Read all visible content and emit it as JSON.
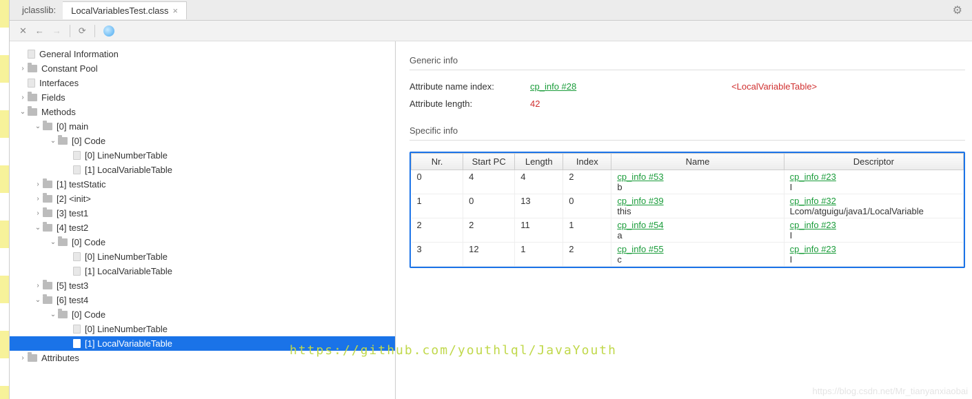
{
  "header": {
    "app": "jclasslib:",
    "tab": "LocalVariablesTest.class"
  },
  "tree": [
    {
      "indent": 0,
      "arrow": "",
      "icon": "file",
      "label": "General Information"
    },
    {
      "indent": 0,
      "arrow": "›",
      "icon": "folder",
      "label": "Constant Pool"
    },
    {
      "indent": 0,
      "arrow": "",
      "icon": "file",
      "label": "Interfaces"
    },
    {
      "indent": 0,
      "arrow": "›",
      "icon": "folder",
      "label": "Fields"
    },
    {
      "indent": 0,
      "arrow": "v",
      "icon": "folder",
      "label": "Methods"
    },
    {
      "indent": 1,
      "arrow": "v",
      "icon": "folder",
      "label": "[0] main"
    },
    {
      "indent": 2,
      "arrow": "v",
      "icon": "folder",
      "label": "[0] Code"
    },
    {
      "indent": 3,
      "arrow": "",
      "icon": "file",
      "label": "[0] LineNumberTable"
    },
    {
      "indent": 3,
      "arrow": "",
      "icon": "file",
      "label": "[1] LocalVariableTable"
    },
    {
      "indent": 1,
      "arrow": "›",
      "icon": "folder",
      "label": "[1] testStatic"
    },
    {
      "indent": 1,
      "arrow": "›",
      "icon": "folder",
      "label": "[2] <init>"
    },
    {
      "indent": 1,
      "arrow": "›",
      "icon": "folder",
      "label": "[3] test1"
    },
    {
      "indent": 1,
      "arrow": "v",
      "icon": "folder",
      "label": "[4] test2"
    },
    {
      "indent": 2,
      "arrow": "v",
      "icon": "folder",
      "label": "[0] Code"
    },
    {
      "indent": 3,
      "arrow": "",
      "icon": "file",
      "label": "[0] LineNumberTable"
    },
    {
      "indent": 3,
      "arrow": "",
      "icon": "file",
      "label": "[1] LocalVariableTable"
    },
    {
      "indent": 1,
      "arrow": "›",
      "icon": "folder",
      "label": "[5] test3"
    },
    {
      "indent": 1,
      "arrow": "v",
      "icon": "folder",
      "label": "[6] test4"
    },
    {
      "indent": 2,
      "arrow": "v",
      "icon": "folder",
      "label": "[0] Code"
    },
    {
      "indent": 3,
      "arrow": "",
      "icon": "file",
      "label": "[0] LineNumberTable"
    },
    {
      "indent": 3,
      "arrow": "",
      "icon": "file",
      "label": "[1] LocalVariableTable",
      "selected": true
    },
    {
      "indent": 0,
      "arrow": "›",
      "icon": "folder",
      "label": "Attributes"
    }
  ],
  "sections": {
    "generic": "Generic info",
    "specific": "Specific info"
  },
  "info": {
    "nameIndexLabel": "Attribute name index:",
    "nameIndexLink": "cp_info #28",
    "nameIndexValue": "<LocalVariableTable>",
    "lengthLabel": "Attribute length:",
    "lengthValue": "42"
  },
  "table": {
    "headers": [
      "Nr.",
      "Start PC",
      "Length",
      "Index",
      "Name",
      "Descriptor"
    ],
    "rows": [
      {
        "nr": "0",
        "startpc": "4",
        "length": "4",
        "index": "2",
        "nameLink": "cp_info #53",
        "nameText": "b",
        "descLink": "cp_info #23",
        "descText": "I"
      },
      {
        "nr": "1",
        "startpc": "0",
        "length": "13",
        "index": "0",
        "nameLink": "cp_info #39",
        "nameText": "this",
        "descLink": "cp_info #32",
        "descText": "Lcom/atguigu/java1/LocalVariable"
      },
      {
        "nr": "2",
        "startpc": "2",
        "length": "11",
        "index": "1",
        "nameLink": "cp_info #54",
        "nameText": "a",
        "descLink": "cp_info #23",
        "descText": "I"
      },
      {
        "nr": "3",
        "startpc": "12",
        "length": "1",
        "index": "2",
        "nameLink": "cp_info #55",
        "nameText": "c",
        "descLink": "cp_info #23",
        "descText": "I"
      }
    ]
  },
  "watermark": "https://github.com/youthlql/JavaYouth",
  "watermark2": "https://blog.csdn.net/Mr_tianyanxiaobai"
}
